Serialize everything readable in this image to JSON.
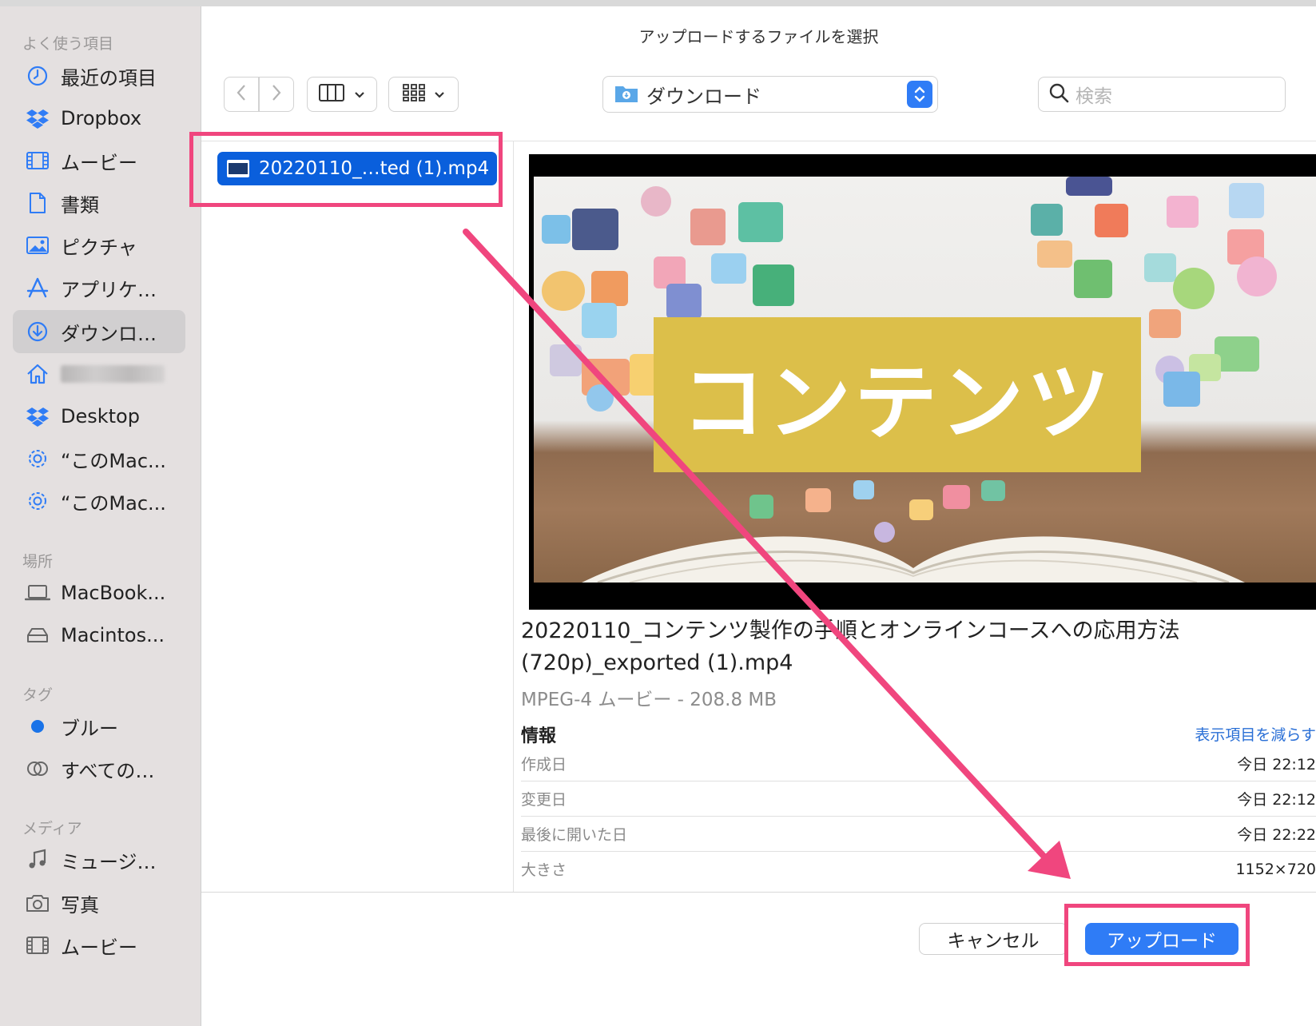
{
  "dialog": {
    "title": "アップロードするファイルを選択"
  },
  "sidebar": {
    "sections": [
      {
        "title": "よく使う項目"
      },
      {
        "title": "場所"
      },
      {
        "title": "タグ"
      },
      {
        "title": "メディア"
      }
    ],
    "favorites": [
      {
        "label": "最近の項目",
        "icon": "clock-icon"
      },
      {
        "label": "Dropbox",
        "icon": "dropbox-icon"
      },
      {
        "label": "ムービー",
        "icon": "film-icon"
      },
      {
        "label": "書類",
        "icon": "document-icon"
      },
      {
        "label": "ピクチャ",
        "icon": "photo-icon"
      },
      {
        "label": "アプリケ…",
        "icon": "apps-icon"
      },
      {
        "label": "ダウンロ…",
        "icon": "download-icon",
        "selected": true
      },
      {
        "label": "",
        "icon": "home-icon"
      },
      {
        "label": "Desktop",
        "icon": "dropbox-icon"
      },
      {
        "label": "“このMac...",
        "icon": "gear-icon"
      },
      {
        "label": "“このMac...",
        "icon": "gear-icon"
      }
    ],
    "locations": [
      {
        "label": "MacBook...",
        "icon": "laptop-icon"
      },
      {
        "label": "Macintos...",
        "icon": "drive-icon"
      }
    ],
    "tags": [
      {
        "label": "ブルー",
        "color": "#1a73e8"
      },
      {
        "label": "すべての…",
        "icon": "tags-icon"
      }
    ],
    "media": [
      {
        "label": "ミュージ…",
        "icon": "music-icon"
      },
      {
        "label": "写真",
        "icon": "camera-icon"
      },
      {
        "label": "ムービー",
        "icon": "film-icon"
      }
    ]
  },
  "toolbar": {
    "location": "ダウンロード",
    "search_placeholder": "検索"
  },
  "file_list": [
    {
      "name": "20220110_…ted (1).mp4",
      "selected": true
    }
  ],
  "preview": {
    "banner_text": "コンテンツ",
    "file_name": "20220110_コンテンツ製作の手順とオンラインコースへの応用方法(720p)_exported (1).mp4",
    "kind_size": "MPEG-4 ムービー - 208.8 MB",
    "info_title": "情報",
    "info_toggle": "表示項目を減らす",
    "info_rows": [
      {
        "key": "作成日",
        "value": "今日 22:12"
      },
      {
        "key": "変更日",
        "value": "今日 22:12"
      },
      {
        "key": "最後に開いた日",
        "value": "今日 22:22"
      },
      {
        "key": "大きさ",
        "value": "1152×720"
      }
    ]
  },
  "buttons": {
    "cancel": "キャンセル",
    "upload": "アップロード"
  },
  "colors": {
    "accent": "#2f7cf6",
    "selection": "#0a5fdc",
    "highlight": "#f0467e",
    "banner": "#dcbf4a"
  }
}
